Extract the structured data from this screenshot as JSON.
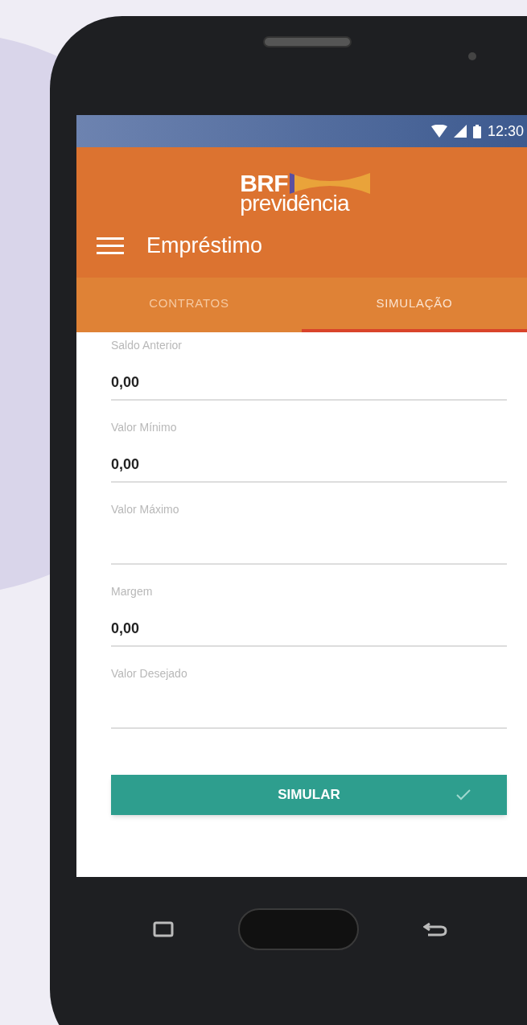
{
  "status_bar": {
    "time": "12:30"
  },
  "logo": {
    "line_1": "BRF",
    "line_2": "previdência"
  },
  "app_bar": {
    "title": "Empréstimo"
  },
  "tabs": [
    {
      "label": "CONTRATOS",
      "selected": false
    },
    {
      "label": "SIMULAÇÃO",
      "selected": true
    }
  ],
  "fields": [
    {
      "label": "Saldo Anterior",
      "value": "0,00"
    },
    {
      "label": "Valor Mínimo",
      "value": "0,00"
    },
    {
      "label": "Valor Máximo"
    },
    {
      "label": "Margem",
      "value": "0,00"
    },
    {
      "label": "Valor Desejado"
    }
  ],
  "button": {
    "label": "SIMULAR"
  }
}
